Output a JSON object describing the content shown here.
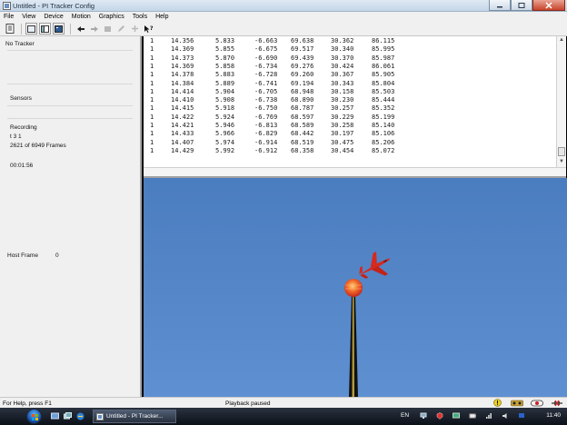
{
  "window": {
    "title": "Untitled - PI Tracker Config"
  },
  "menubar": {
    "items": [
      "File",
      "View",
      "Device",
      "Motion",
      "Graphics",
      "Tools",
      "Help"
    ]
  },
  "leftpanel": {
    "tracker_status": "No Tracker",
    "sensors_label": "Sensors",
    "recording_label": "Recording",
    "recording_name": "t 3 1",
    "frames": "2621 of 6949 Frames",
    "elapsed": "00:01:56",
    "host_frame_label": "Host Frame",
    "host_frame_value": "0"
  },
  "datatable": {
    "rows": [
      [
        "1",
        "14.356",
        "5.833",
        "-6.663",
        "69.638",
        "30.362",
        "86.115"
      ],
      [
        "1",
        "14.369",
        "5.855",
        "-6.675",
        "69.517",
        "30.340",
        "85.995"
      ],
      [
        "1",
        "14.373",
        "5.870",
        "-6.690",
        "69.439",
        "30.370",
        "85.987"
      ],
      [
        "1",
        "14.369",
        "5.858",
        "-6.734",
        "69.276",
        "30.424",
        "86.061"
      ],
      [
        "1",
        "14.378",
        "5.883",
        "-6.728",
        "69.260",
        "30.367",
        "85.905"
      ],
      [
        "1",
        "14.384",
        "5.889",
        "-6.741",
        "69.194",
        "30.343",
        "85.804"
      ],
      [
        "1",
        "14.414",
        "5.904",
        "-6.705",
        "68.948",
        "30.158",
        "85.503"
      ],
      [
        "1",
        "14.410",
        "5.908",
        "-6.738",
        "68.890",
        "30.230",
        "85.444"
      ],
      [
        "1",
        "14.415",
        "5.918",
        "-6.750",
        "68.787",
        "30.257",
        "85.352"
      ],
      [
        "1",
        "14.422",
        "5.924",
        "-6.769",
        "68.597",
        "30.229",
        "85.199"
      ],
      [
        "1",
        "14.421",
        "5.946",
        "-6.813",
        "68.589",
        "30.258",
        "85.140"
      ],
      [
        "1",
        "14.433",
        "5.966",
        "-6.829",
        "68.442",
        "30.197",
        "85.106"
      ],
      [
        "1",
        "14.407",
        "5.974",
        "-6.914",
        "68.519",
        "30.475",
        "85.206"
      ],
      [
        "1",
        "14.429",
        "5.992",
        "-6.912",
        "68.358",
        "30.454",
        "85.072"
      ]
    ]
  },
  "statusbar": {
    "help_text": "For Help, press F1",
    "playback_text": "Playback paused"
  },
  "taskbar": {
    "task_label": "Untitled - PI Tracker...",
    "language": "EN",
    "clock": "11:40"
  },
  "colors": {
    "sky": "#5687c7",
    "jet": "#d42a20",
    "sun": "#f0441e",
    "tower": "#1a1a1a"
  }
}
